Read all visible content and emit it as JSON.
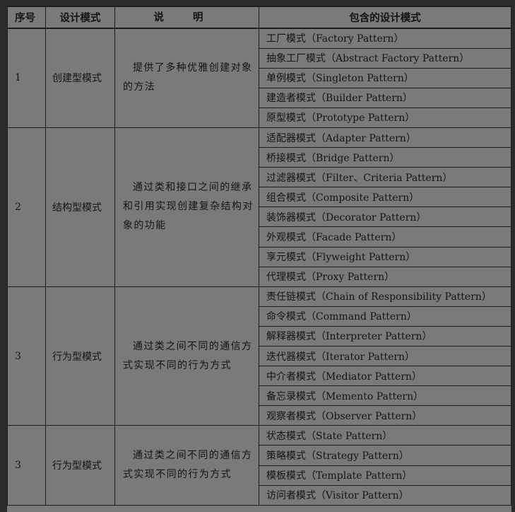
{
  "table": {
    "headers": {
      "index": "序号",
      "category": "设计模式",
      "description": "说 明",
      "patterns": "包含的设计模式"
    },
    "groups": [
      {
        "index": "1",
        "category": "创建型模式",
        "description": "提供了多种优雅创建对象的方法",
        "patterns": [
          "工厂模式（Factory Pattern）",
          "抽象工厂模式（Abstract Factory Pattern）",
          "单例模式（Singleton Pattern）",
          "建造者模式（Builder Pattern）",
          "原型模式（Prototype Pattern）"
        ]
      },
      {
        "index": "2",
        "category": "结构型模式",
        "description": "通过类和接口之间的继承和引用实现创建复杂结构对象的功能",
        "patterns": [
          "适配器模式（Adapter Pattern）",
          "桥接模式（Bridge Pattern）",
          "过滤器模式（Filter、Criteria Pattern）",
          "组合模式（Composite Pattern）",
          "装饰器模式（Decorator Pattern）",
          "外观模式（Facade Pattern）",
          "享元模式（Flyweight Pattern）",
          "代理模式（Proxy Pattern）"
        ]
      },
      {
        "index": "3",
        "category": "行为型模式",
        "description": "通过类之间不同的通信方式实现不同的行为方式",
        "patterns": [
          "责任链模式（Chain of Responsibility Pattern）",
          "命令模式（Command Pattern）",
          "解释器模式（Interpreter Pattern）",
          "迭代器模式（Iterator Pattern）",
          "中介者模式（Mediator Pattern）",
          "备忘录模式（Memento Pattern）",
          "观察者模式（Observer Pattern）"
        ]
      },
      {
        "index": "3",
        "category": "行为型模式",
        "description": "通过类之间不同的通信方式实现不同的行为方式",
        "patterns": [
          "状态模式（State Pattern）",
          "策略模式（Strategy Pattern）",
          "模板模式（Template Pattern）",
          "访问者模式（Visitor Pattern）"
        ]
      }
    ]
  }
}
